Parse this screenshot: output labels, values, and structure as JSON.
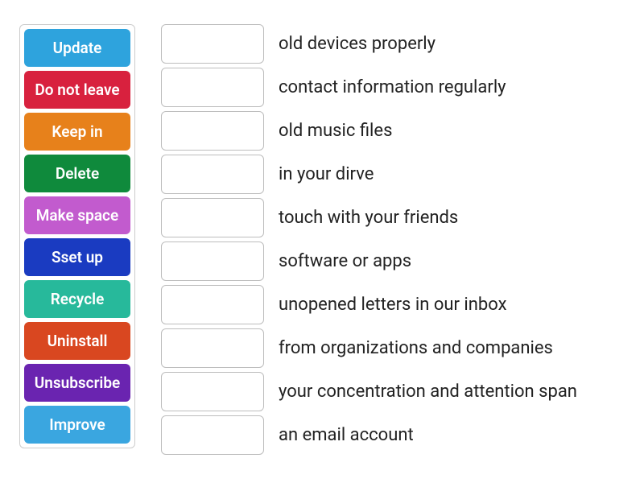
{
  "word_bank": [
    {
      "label": "Update",
      "color_class": "c0"
    },
    {
      "label": "Do not leave",
      "color_class": "c1"
    },
    {
      "label": "Keep in",
      "color_class": "c2"
    },
    {
      "label": "Delete",
      "color_class": "c3"
    },
    {
      "label": "Make space",
      "color_class": "c4"
    },
    {
      "label": "Sset up",
      "color_class": "c5"
    },
    {
      "label": "Recycle",
      "color_class": "c6"
    },
    {
      "label": "Uninstall",
      "color_class": "c7"
    },
    {
      "label": "Unsubscribe",
      "color_class": "c8"
    },
    {
      "label": "Improve",
      "color_class": "c9"
    }
  ],
  "targets": [
    {
      "phrase": "old devices properly"
    },
    {
      "phrase": "contact information regularly"
    },
    {
      "phrase": "old music files"
    },
    {
      "phrase": "in your dirve"
    },
    {
      "phrase": "touch with your friends"
    },
    {
      "phrase": "software or apps"
    },
    {
      "phrase": "unopened letters in our inbox"
    },
    {
      "phrase": "from organizations and companies"
    },
    {
      "phrase": "your concentration and attention span"
    },
    {
      "phrase": "an email account"
    }
  ]
}
